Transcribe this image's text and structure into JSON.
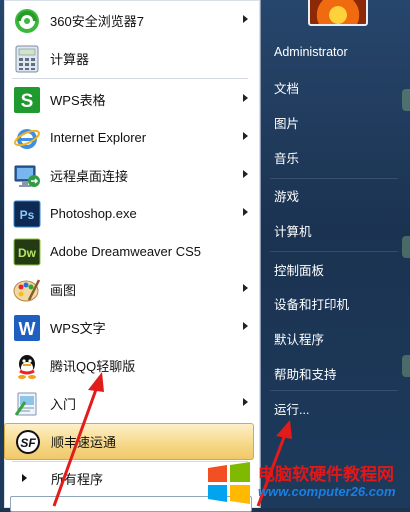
{
  "programs": [
    {
      "label": "360安全浏览器7",
      "icon": "360-browser-icon",
      "arrow": true
    },
    {
      "label": "计算器",
      "icon": "calculator-icon",
      "arrow": false
    },
    {
      "label": "WPS表格",
      "icon": "wps-spreadsheet-icon",
      "arrow": true
    },
    {
      "label": "Internet Explorer",
      "icon": "internet-explorer-icon",
      "arrow": true
    },
    {
      "label": "远程桌面连接",
      "icon": "remote-desktop-icon",
      "arrow": true
    },
    {
      "label": "Photoshop.exe",
      "icon": "photoshop-icon",
      "arrow": true
    },
    {
      "label": "Adobe Dreamweaver CS5",
      "icon": "dreamweaver-icon",
      "arrow": false
    },
    {
      "label": "画图",
      "icon": "paint-icon",
      "arrow": true
    },
    {
      "label": "WPS文字",
      "icon": "wps-writer-icon",
      "arrow": true
    },
    {
      "label": "腾讯QQ轻聊版",
      "icon": "qq-icon",
      "arrow": false
    },
    {
      "label": "入门",
      "icon": "getting-started-icon",
      "arrow": true
    },
    {
      "label": "顺丰速运通",
      "icon": "sf-express-icon",
      "arrow": false,
      "highlighted": true
    }
  ],
  "all_programs": "所有程序",
  "right_items": [
    {
      "label": "Administrator"
    },
    {
      "label": "文档"
    },
    {
      "label": "图片"
    },
    {
      "label": "音乐"
    },
    {
      "label": "游戏"
    },
    {
      "label": "计算机"
    },
    {
      "label": "控制面板"
    },
    {
      "label": "设备和打印机"
    },
    {
      "label": "默认程序"
    },
    {
      "label": "帮助和支持"
    },
    {
      "label": "运行..."
    }
  ],
  "watermark": {
    "title": "电脑软硬件教程网",
    "url": "www.computer26.com"
  },
  "colors": {
    "annotation_red": "#e21b1b",
    "highlight": "#f6d98a",
    "panel_right": "#1b3351"
  }
}
